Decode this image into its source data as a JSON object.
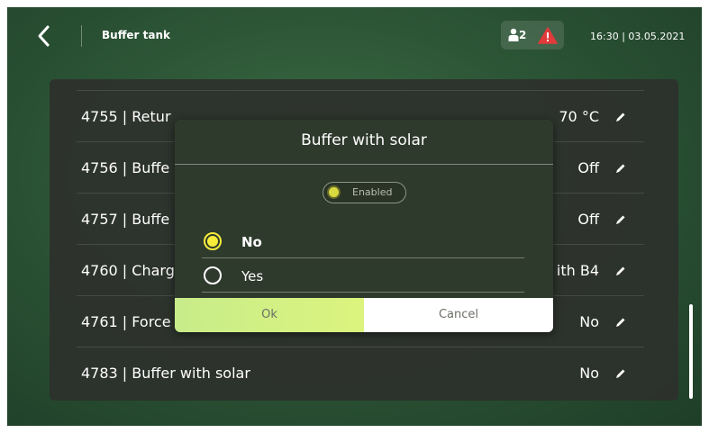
{
  "header": {
    "back_icon": "chevron-left-icon",
    "title": "Buffer tank",
    "user_icon": "user-icon",
    "user_count": "2",
    "warning_icon": "warning-triangle-icon",
    "datetime": "16:30 | 03.05.2021"
  },
  "list": {
    "rows": [
      {
        "label": "4755 | Retur",
        "value": "70 °C"
      },
      {
        "label": "4756 | Buffe",
        "value": "Off"
      },
      {
        "label": "4757 | Buffe",
        "value": "Off"
      },
      {
        "label": "4760 | Charg",
        "value": "ith B4"
      },
      {
        "label": "4761 | Force",
        "value": "No"
      },
      {
        "label": "4783 | Buffer with solar",
        "value": "No"
      }
    ],
    "edit_icon": "pencil-icon"
  },
  "dialog": {
    "title": "Buffer with solar",
    "enabled_label": "Enabled",
    "options": [
      {
        "label": "No",
        "selected": true
      },
      {
        "label": "Yes",
        "selected": false
      }
    ],
    "ok_label": "Ok",
    "cancel_label": "Cancel"
  },
  "colors": {
    "accent_yellow": "#f7ec3a",
    "ok_button": "#d4f183",
    "panel": "#2d302c",
    "warning": "#e03a3a"
  }
}
